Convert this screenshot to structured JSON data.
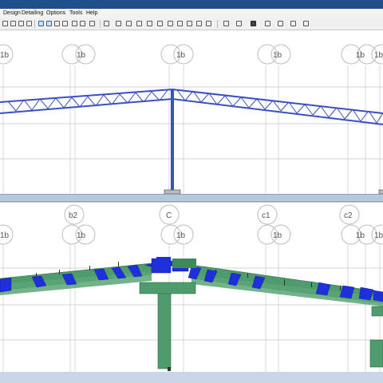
{
  "menu": {
    "items": [
      "Design",
      "Detailing",
      "Options",
      "Tools",
      "Help"
    ]
  },
  "toolbar": {
    "icons": [
      "undo-icon",
      "redo-icon",
      "arrow-up-icon",
      "arrow-down-icon",
      "select-icon",
      "check-icon",
      "grid-icon",
      "frame-icon",
      "member-icon",
      "beam-icon",
      "column-icon",
      "tool-icon",
      "ruler-icon",
      "section-icon",
      "filter-icon",
      "view-icon",
      "layout-icon"
    ]
  },
  "top_view": {
    "gridlines": [
      {
        "label": "1b"
      },
      {
        "label": "1b"
      },
      {
        "label": "1b"
      },
      {
        "label": "1b"
      },
      {
        "label": "1b"
      },
      {
        "label": "1b"
      }
    ]
  },
  "bottom_view": {
    "grid_letters": [
      "b2",
      "C",
      "c1",
      "c2"
    ],
    "gridlines": [
      {
        "label": "1b"
      },
      {
        "label": "1b"
      },
      {
        "label": "1b"
      },
      {
        "label": "1b"
      },
      {
        "label": "1b"
      },
      {
        "label": "1b"
      }
    ]
  },
  "colors": {
    "truss_blue": "#3a4fc4",
    "stress_green": "#4e9b6b",
    "overstress_blue": "#1f2fdc"
  }
}
